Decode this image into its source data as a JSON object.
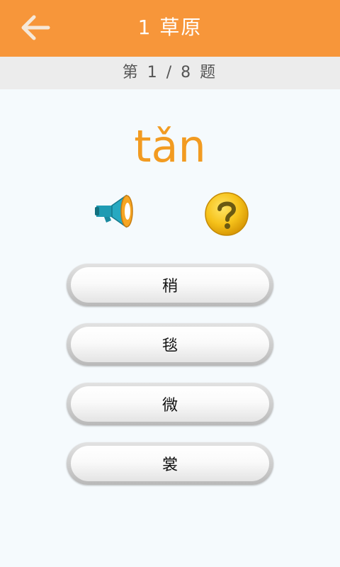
{
  "header": {
    "title": "1 草原",
    "back_icon": "arrow-left-icon",
    "background_color": "#f7963a"
  },
  "progress": {
    "label": "第 1 / 8 题"
  },
  "question": {
    "pinyin": "tǎn",
    "pinyin_color": "#f29b21"
  },
  "controls": {
    "speaker_icon": "megaphone-icon",
    "help_icon": "question-mark-icon"
  },
  "options": [
    {
      "label": "稍"
    },
    {
      "label": "毯"
    },
    {
      "label": "微"
    },
    {
      "label": "裳"
    }
  ]
}
